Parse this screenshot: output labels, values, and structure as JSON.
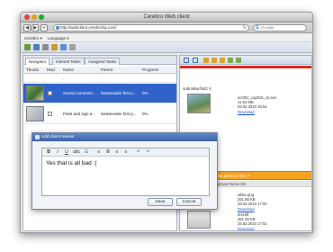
{
  "window": {
    "title": "Cerebro Web client"
  },
  "browser": {
    "url": "http://webclient.cerebrohq.com/",
    "search_placeholder": "Google"
  },
  "menu": {
    "items": [
      "Cerebro ▾",
      "Language ▾"
    ]
  },
  "left_pane": {
    "tabs": [
      "Navigator",
      "Interest Tasks",
      "Assigned Tasks"
    ],
    "columns": [
      "Thumb",
      "Mod",
      "Name",
      "Parent",
      "Progress"
    ],
    "rows": [
      {
        "name": "..",
        "parent": "",
        "progress": "",
        "selected": false
      },
      {
        "name": "Sound comment ...",
        "parent": "/testaneider first p...",
        "progress": "0%",
        "selected": true
      },
      {
        "name": "Paint and sign a...",
        "parent": "/testaneider first p...",
        "progress": "0%",
        "selected": false
      }
    ]
  },
  "right_pane": {
    "title": "submitter/list2 X",
    "files": [
      {
        "name": "scr001_cap015_v2.avs",
        "size": "11.94 MB",
        "date": "25.03.2010 16:54",
        "link": "Download"
      },
      {
        "name": "white.png",
        "size": "251.86 KB",
        "date": "25.03.2010 17:02",
        "link": "Download"
      },
      {
        "name": "test.tiff",
        "size": "461.30 KB",
        "date": "25.03.2010 17:02",
        "link": "Download"
      }
    ],
    "report": "Report - Tetzlaf (13.06.2010 17:42) ✔",
    "approved": "Related Items 0/2 Approved Items 0/2"
  },
  "dialog": {
    "title": "Add client review",
    "toolbar": [
      "B",
      "I",
      "U",
      "abc",
      "☰",
      "≡",
      "≣",
      "≡",
      "≡",
      "↶",
      "↷"
    ],
    "text": "Yes that is all bad :(",
    "save_label": "Save",
    "cancel_label": "Cancel"
  }
}
